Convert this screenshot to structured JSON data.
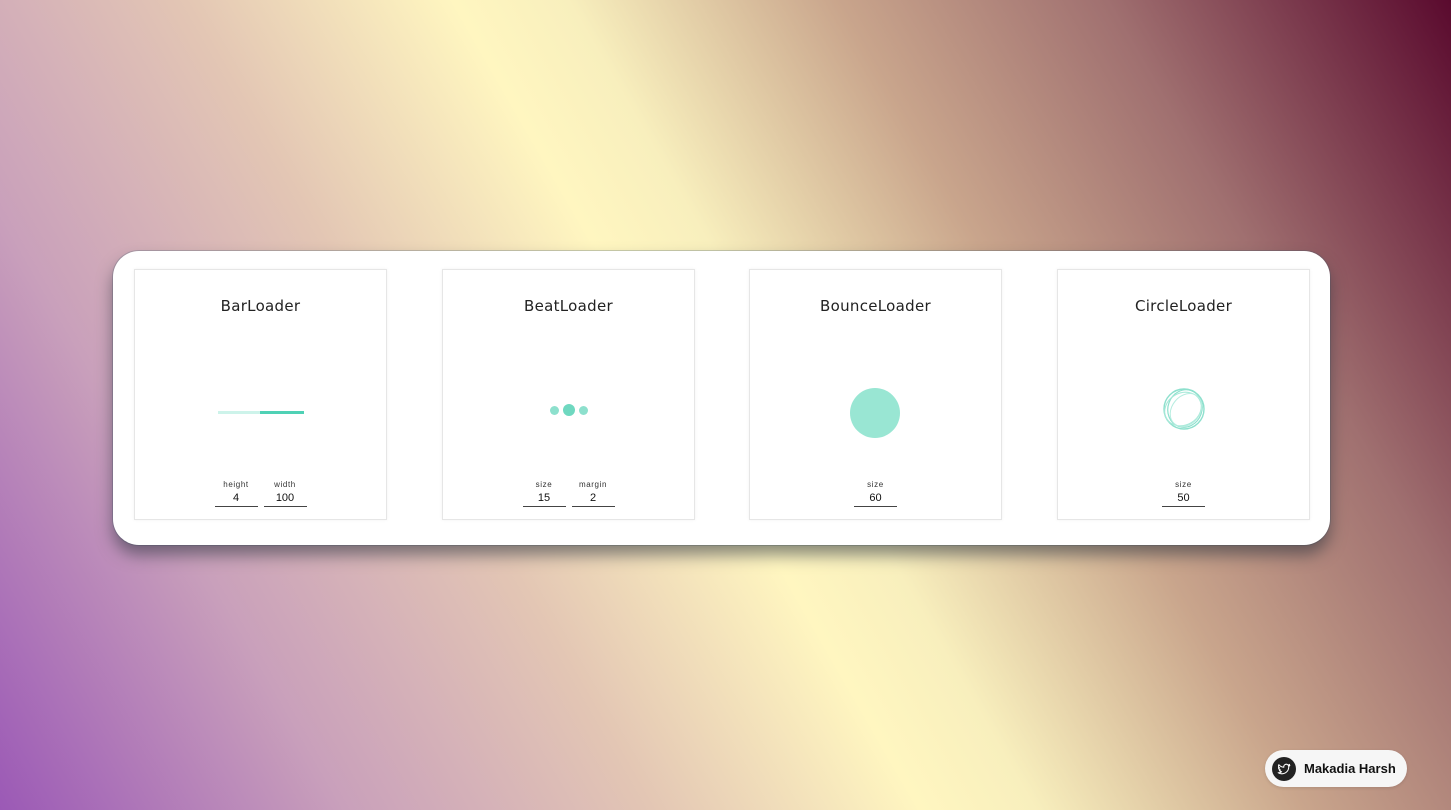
{
  "loaders": [
    {
      "title": "BarLoader",
      "controls": [
        {
          "label": "height",
          "value": "4"
        },
        {
          "label": "width",
          "value": "100"
        }
      ]
    },
    {
      "title": "BeatLoader",
      "controls": [
        {
          "label": "size",
          "value": "15"
        },
        {
          "label": "margin",
          "value": "2"
        }
      ]
    },
    {
      "title": "BounceLoader",
      "controls": [
        {
          "label": "size",
          "value": "60"
        }
      ]
    },
    {
      "title": "CircleLoader",
      "controls": [
        {
          "label": "size",
          "value": "50"
        }
      ]
    }
  ],
  "colors": {
    "accent": "#4fd1b5",
    "accent_light": "#99e6d3",
    "track": "#cdf3ea"
  },
  "badge": {
    "icon": "twitter-bird-icon",
    "name": "Makadia Harsh"
  }
}
